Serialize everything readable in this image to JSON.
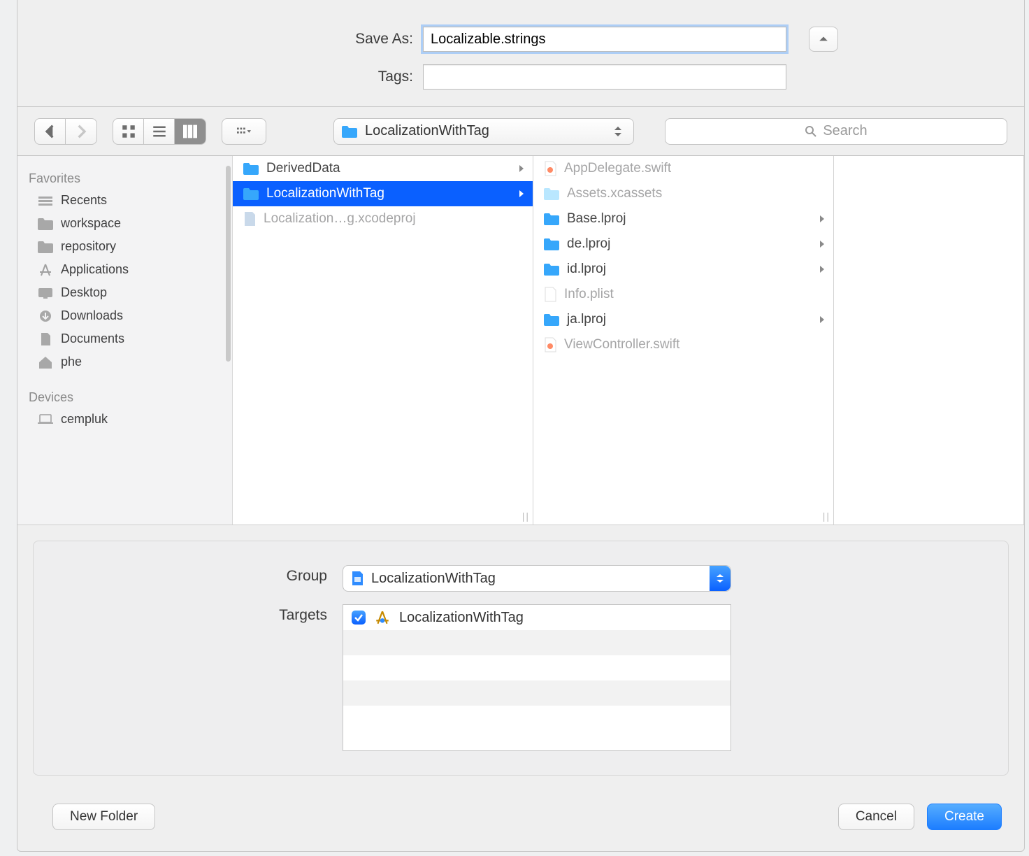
{
  "header": {
    "save_as_label": "Save As:",
    "save_as_value": "Localizable.strings",
    "tags_label": "Tags:",
    "tags_value": ""
  },
  "toolbar": {
    "path_value": "LocalizationWithTag",
    "search_placeholder": "Search"
  },
  "sidebar": {
    "favorites_label": "Favorites",
    "devices_label": "Devices",
    "favorites": [
      {
        "icon": "recents",
        "label": "Recents"
      },
      {
        "icon": "folder",
        "label": "workspace"
      },
      {
        "icon": "folder",
        "label": "repository"
      },
      {
        "icon": "apps",
        "label": "Applications"
      },
      {
        "icon": "desktop",
        "label": "Desktop"
      },
      {
        "icon": "download",
        "label": "Downloads"
      },
      {
        "icon": "doc",
        "label": "Documents"
      },
      {
        "icon": "home",
        "label": "phe"
      }
    ],
    "devices": [
      {
        "icon": "laptop",
        "label": "cempluk"
      }
    ]
  },
  "columns": {
    "col1": [
      {
        "icon": "folder",
        "label": "DerivedData",
        "chev": true
      },
      {
        "icon": "folder",
        "label": "LocalizationWithTag",
        "chev": true,
        "selected": true
      },
      {
        "icon": "xcodeproj",
        "label": "Localization…g.xcodeproj",
        "faded": true
      }
    ],
    "col2": [
      {
        "icon": "swift",
        "label": "AppDelegate.swift",
        "faded": true
      },
      {
        "icon": "folder-light",
        "label": "Assets.xcassets",
        "faded": true
      },
      {
        "icon": "folder",
        "label": "Base.lproj",
        "chev": true
      },
      {
        "icon": "folder",
        "label": "de.lproj",
        "chev": true
      },
      {
        "icon": "folder",
        "label": "id.lproj",
        "chev": true
      },
      {
        "icon": "plist",
        "label": "Info.plist",
        "faded": true
      },
      {
        "icon": "folder",
        "label": "ja.lproj",
        "chev": true
      },
      {
        "icon": "swift",
        "label": "ViewController.swift",
        "faded": true
      }
    ]
  },
  "options": {
    "group_label": "Group",
    "group_value": "LocalizationWithTag",
    "targets_label": "Targets",
    "targets": [
      {
        "checked": true,
        "label": "LocalizationWithTag"
      }
    ]
  },
  "footer": {
    "new_folder": "New Folder",
    "cancel": "Cancel",
    "create": "Create"
  }
}
